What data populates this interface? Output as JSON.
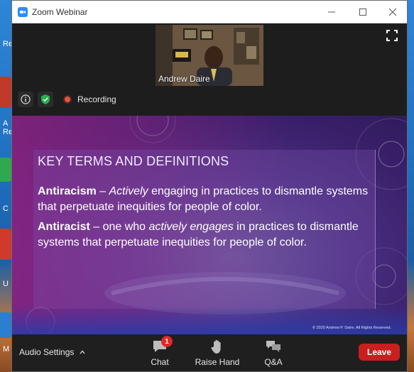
{
  "desktop": {
    "left_labels": [
      "Re",
      "A",
      "Re",
      "C",
      "U",
      "M"
    ]
  },
  "window": {
    "title": "Zoom Webinar",
    "controls": [
      "minimize",
      "maximize",
      "close"
    ]
  },
  "video": {
    "speaker_name": "Andrew Daire",
    "recording_label": "Recording"
  },
  "slide": {
    "heading": "KEY TERMS AND DEFINITIONS",
    "term1": {
      "term": "Antiracism",
      "dash": " – ",
      "emph": "Actively",
      "rest": " engaging in practices to dismantle systems that perpetuate inequities for people of color."
    },
    "term2": {
      "term": "Antiracist",
      "before": " – one who ",
      "emph": "actively engages",
      "rest": " in practices to dismantle systems that perpetuate inequities for people of color."
    },
    "copyright": "© 2020 Andrew P. Daire. All Rights Reserved."
  },
  "toolbar": {
    "audio_settings": "Audio Settings",
    "chat_label": "Chat",
    "chat_badge": "1",
    "raise_hand_label": "Raise Hand",
    "qa_label": "Q&A",
    "leave_label": "Leave"
  },
  "colors": {
    "zoom_blue": "#2d8cff",
    "leave_red": "#c81f1f",
    "recording_red": "#e8533f",
    "badge_red": "#e02828"
  }
}
